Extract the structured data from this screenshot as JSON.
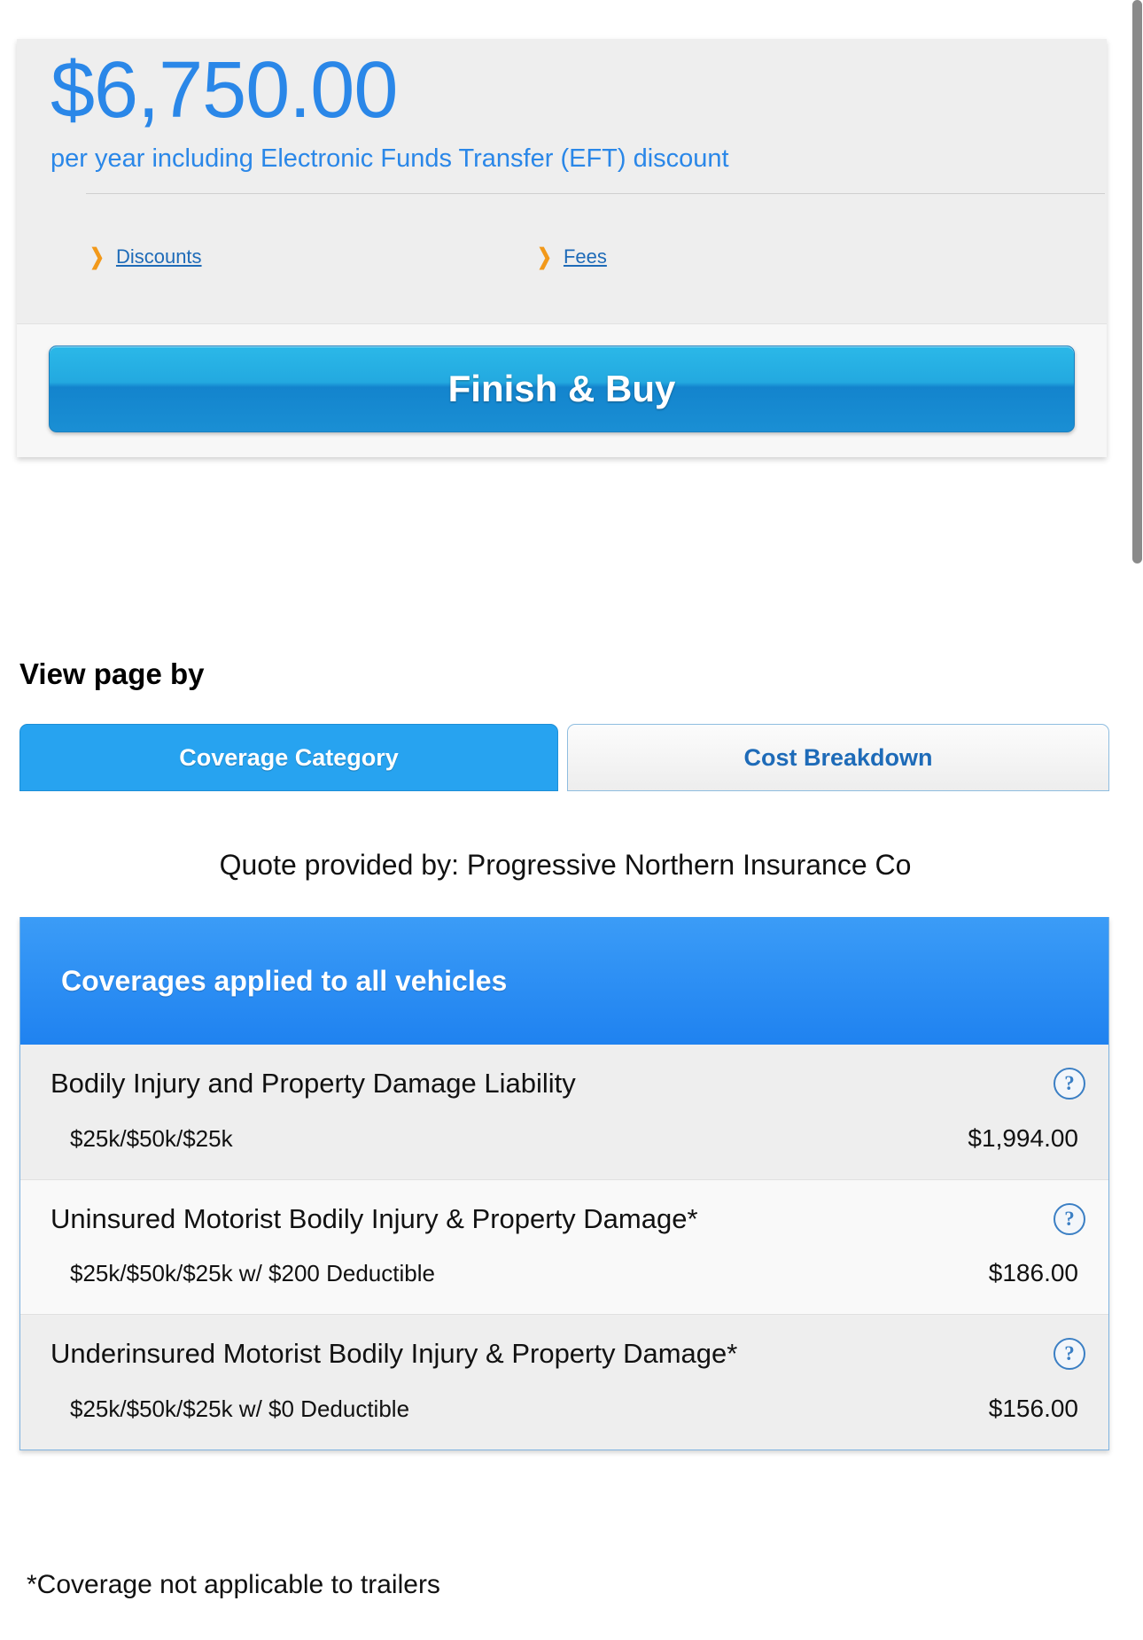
{
  "premium": {
    "amount": "$6,750.00",
    "subtitle": "per year including Electronic Funds Transfer (EFT) discount",
    "links": [
      {
        "label": "Discounts",
        "icon": "chevron-right-icon",
        "glyph": "❯"
      },
      {
        "label": "Fees",
        "icon": "chevron-right-icon",
        "glyph": "❯"
      }
    ],
    "cta_label": "Finish & Buy"
  },
  "view_by": {
    "label": "View page by",
    "tabs": [
      {
        "label": "Coverage Category",
        "active": true
      },
      {
        "label": "Cost Breakdown",
        "active": false
      }
    ]
  },
  "quote_provided_by": "Quote provided by: Progressive Northern Insurance Co",
  "coverage_card": {
    "header": "Coverages applied to all vehicles",
    "help_glyph": "?",
    "rows": [
      {
        "title": "Bodily Injury and Property Damage Liability",
        "limits": "$25k/$50k/$25k",
        "price": "$1,994.00"
      },
      {
        "title": "Uninsured Motorist Bodily Injury & Property Damage*",
        "limits": "$25k/$50k/$25k w/ $200 Deductible",
        "price": "$186.00"
      },
      {
        "title": "Underinsured Motorist Bodily Injury & Property Damage*",
        "limits": "$25k/$50k/$25k w/ $0 Deductible",
        "price": "$156.00"
      }
    ]
  },
  "footnote": "*Coverage not applicable to trailers",
  "colors": {
    "accent_blue": "#2a87e8",
    "header_blue": "#1f82f0",
    "tab_active": "#27a3f0",
    "link_blue": "#1e6bb8",
    "chevron_orange": "#f2991a"
  }
}
